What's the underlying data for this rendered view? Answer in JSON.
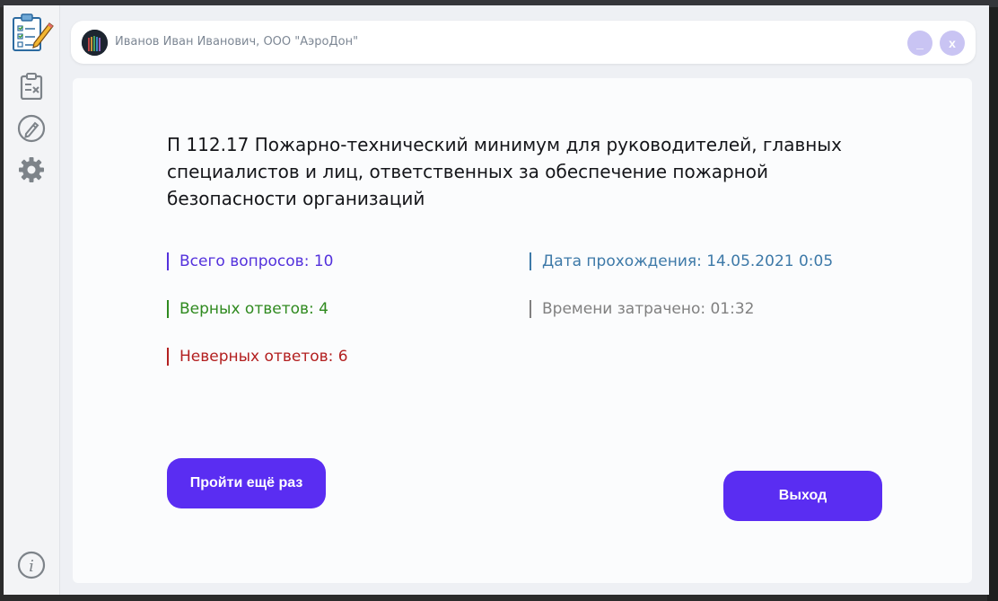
{
  "header": {
    "user_name": "Иванов Иван Иванович, ООО \"АэроДон\"",
    "minimize_label": "_",
    "close_label": "x"
  },
  "sidebar": {
    "items": [
      {
        "name": "tests",
        "icon": "clipboard-icon"
      },
      {
        "name": "edit",
        "icon": "pencil-icon"
      },
      {
        "name": "settings",
        "icon": "gear-icon"
      },
      {
        "name": "info",
        "icon": "info-icon"
      }
    ]
  },
  "result": {
    "title": "П 112.17 Пожарно-технический минимум для руководителей, главных специалистов и лиц, ответственных за обеспечение пожарной безопасности организаций",
    "total_questions": "Всего вопросов: 10",
    "correct_answers": "Верных ответов: 4",
    "wrong_answers": "Неверных ответов: 6",
    "date": "Дата прохождения: 14.05.2021 0:05",
    "time_spent": "Времени затрачено: 01:32"
  },
  "actions": {
    "retry_label": "Пройти ещё раз",
    "exit_label": "Выход"
  },
  "colors": {
    "accent": "#5a2df2",
    "total": "#5331dc",
    "correct": "#2f8a1f",
    "wrong": "#b32020",
    "date": "#3d79a8",
    "time": "#808080"
  }
}
